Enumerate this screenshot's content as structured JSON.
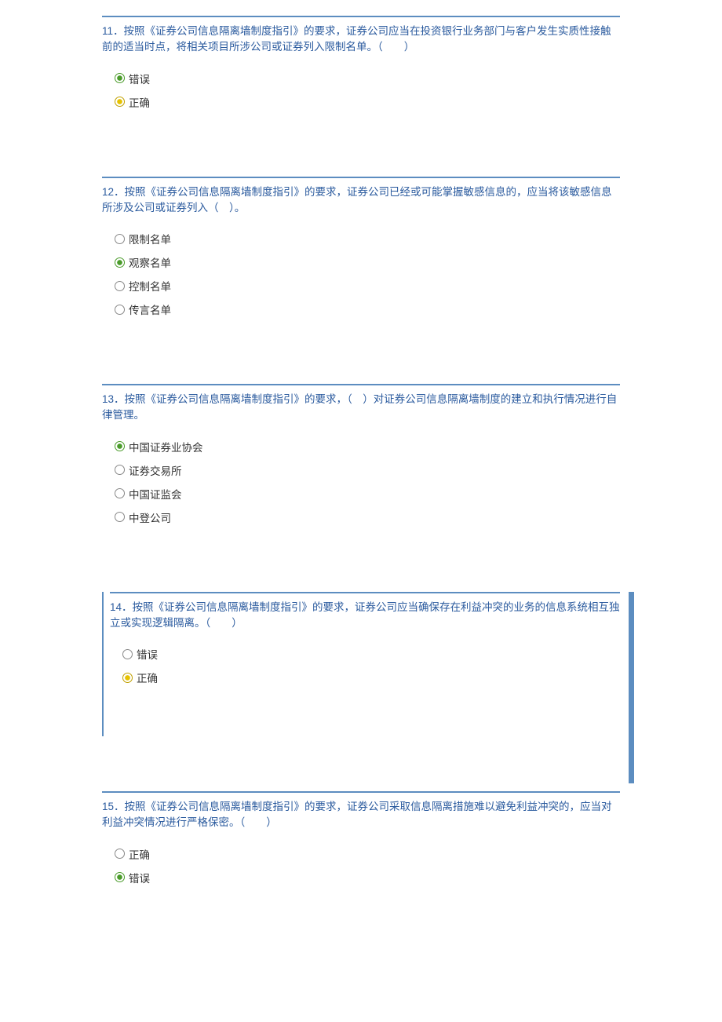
{
  "questions": [
    {
      "number": "11．",
      "text": "按照《证券公司信息隔离墙制度指引》的要求，证券公司应当在投资银行业务部门与客户发生实质性接触前的适当时点，将相关项目所涉公司或证券列入限制名单。（　　）",
      "options": [
        {
          "label": "错误",
          "state": "selected"
        },
        {
          "label": "正确",
          "state": "selected-yellow"
        }
      ]
    },
    {
      "number": "12．",
      "text": "按照《证券公司信息隔离墙制度指引》的要求，证券公司已经或可能掌握敏感信息的，应当将该敏感信息所涉及公司或证券列入（　）。",
      "options": [
        {
          "label": "限制名单",
          "state": ""
        },
        {
          "label": "观察名单",
          "state": "selected"
        },
        {
          "label": "控制名单",
          "state": ""
        },
        {
          "label": "传言名单",
          "state": ""
        }
      ]
    },
    {
      "number": "13．",
      "text": "按照《证券公司信息隔离墙制度指引》的要求，（　）对证券公司信息隔离墙制度的建立和执行情况进行自律管理。",
      "options": [
        {
          "label": "中国证券业协会",
          "state": "selected"
        },
        {
          "label": "证券交易所",
          "state": ""
        },
        {
          "label": "中国证监会",
          "state": ""
        },
        {
          "label": "中登公司",
          "state": ""
        }
      ]
    },
    {
      "number": "14．",
      "text": "按照《证券公司信息隔离墙制度指引》的要求，证券公司应当确保存在利益冲突的业务的信息系统相互独立或实现逻辑隔离。（　　）",
      "options": [
        {
          "label": "错误",
          "state": ""
        },
        {
          "label": "正确",
          "state": "selected-yellow"
        }
      ]
    },
    {
      "number": "15．",
      "text": "按照《证券公司信息隔离墙制度指引》的要求，证券公司采取信息隔离措施难以避免利益冲突的，应当对利益冲突情况进行严格保密。（　　）",
      "options": [
        {
          "label": "正确",
          "state": ""
        },
        {
          "label": "错误",
          "state": "selected"
        }
      ]
    }
  ]
}
